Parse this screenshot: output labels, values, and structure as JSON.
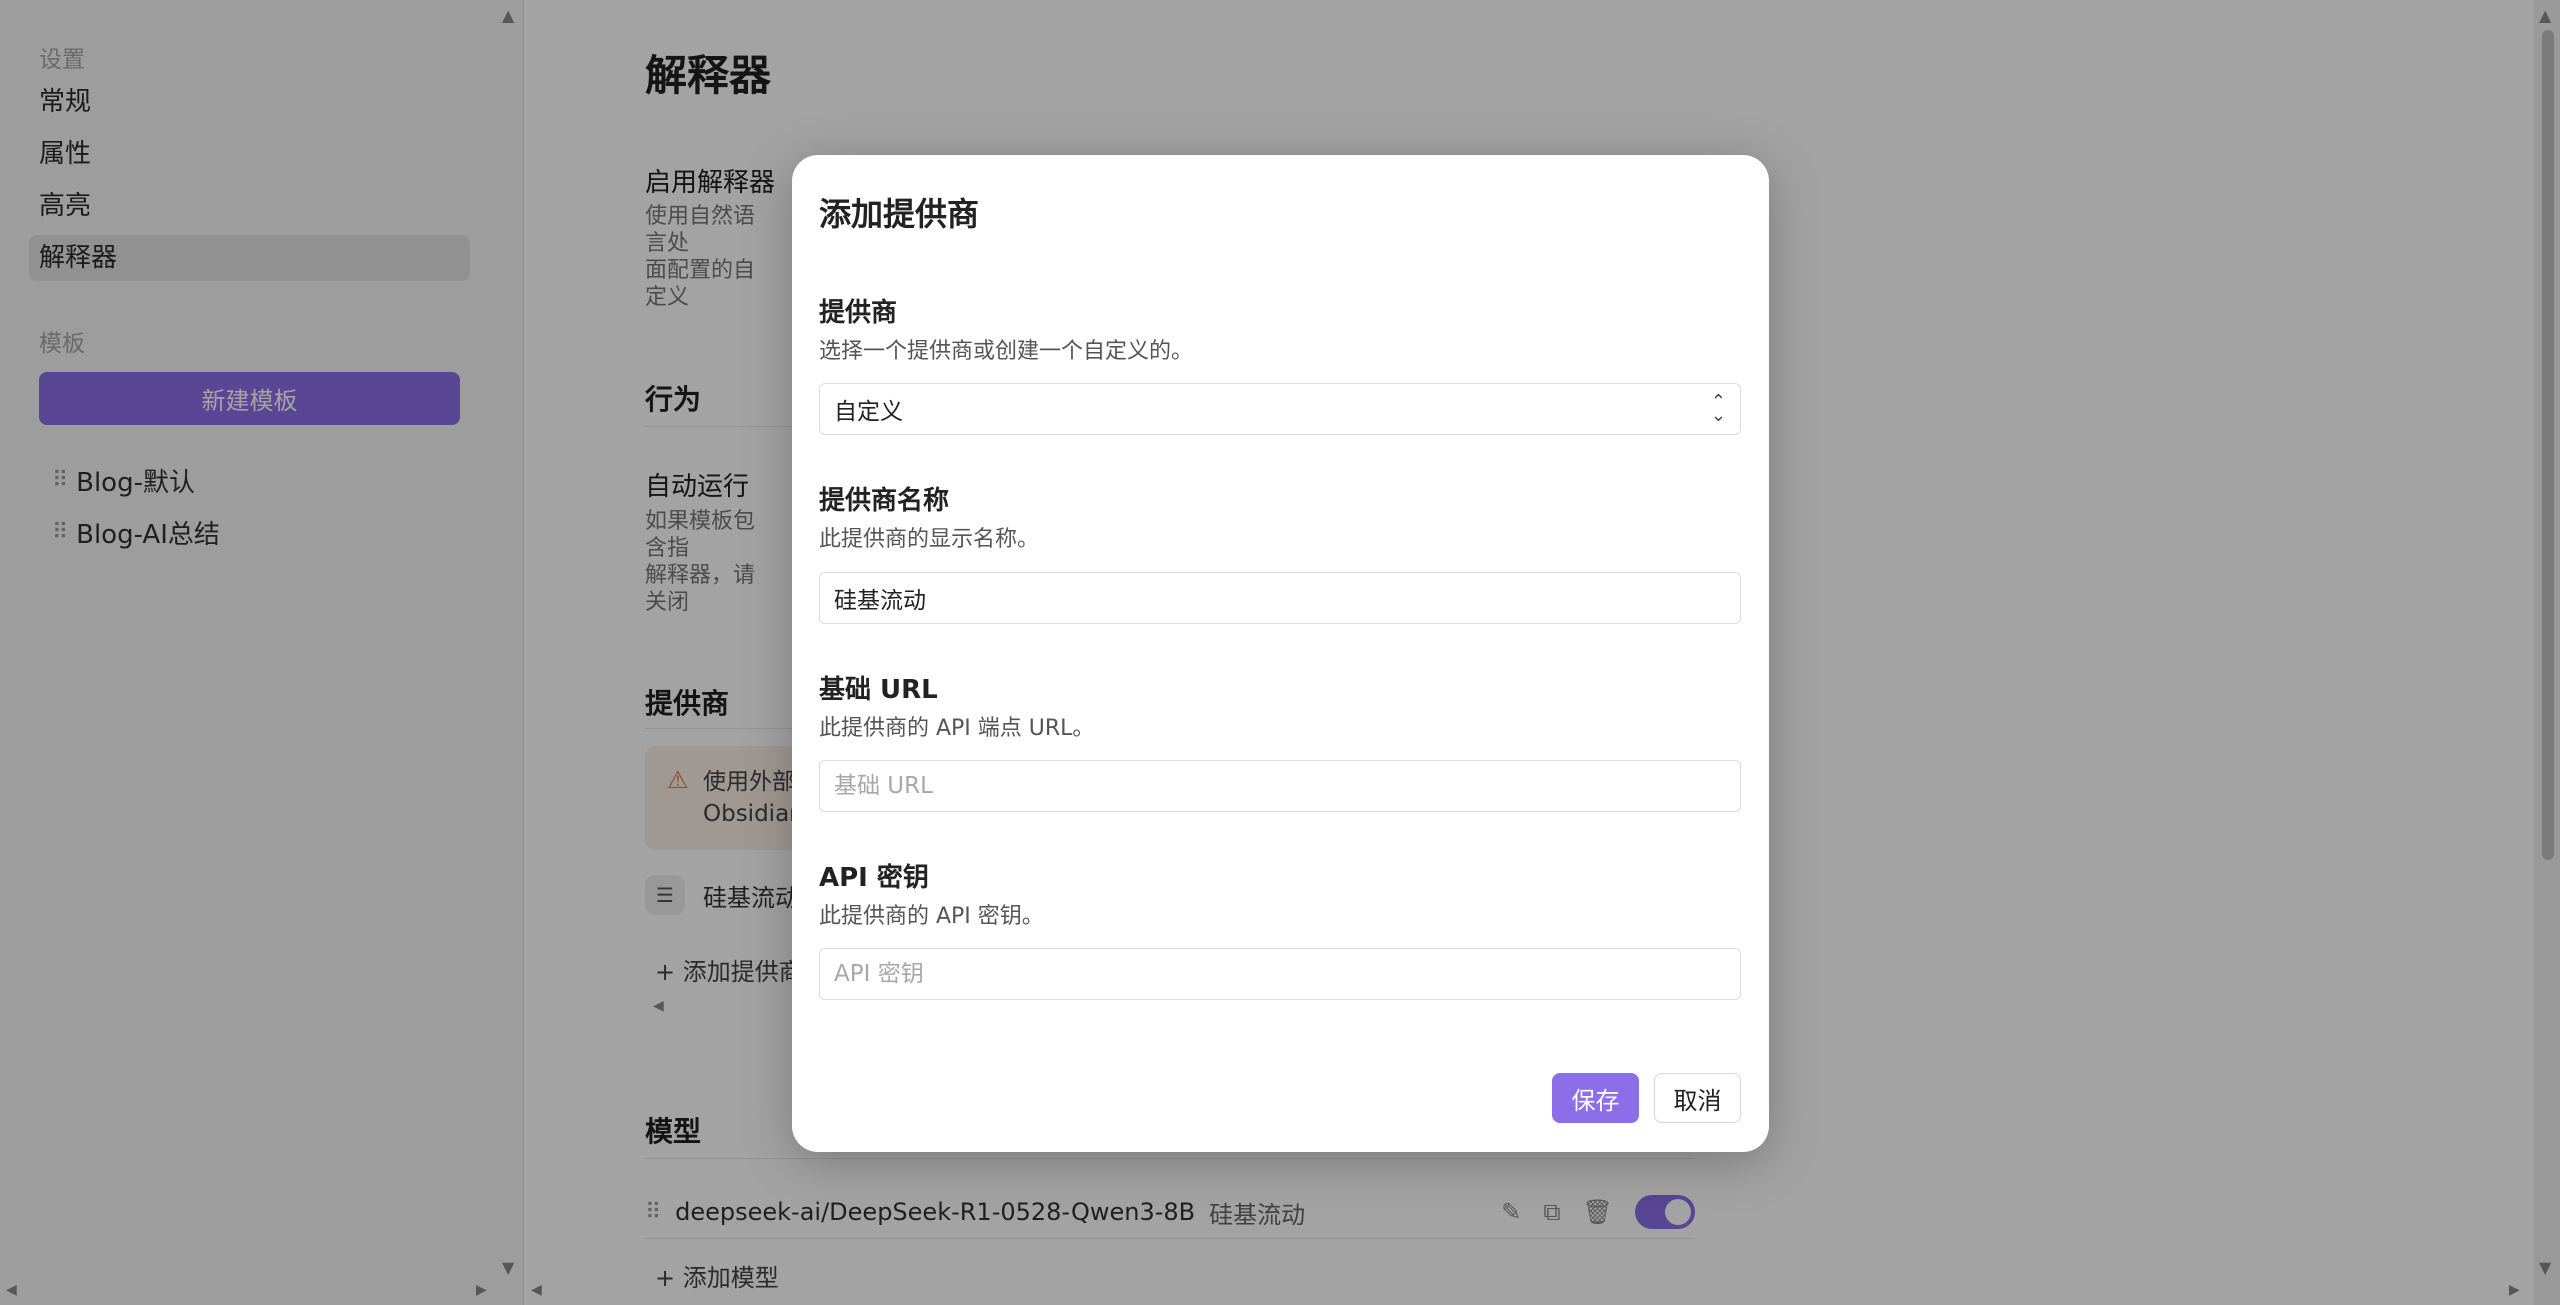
{
  "sidebar": {
    "settings_heading": "设置",
    "items": [
      {
        "label": "常规"
      },
      {
        "label": "属性"
      },
      {
        "label": "高亮"
      },
      {
        "label": "解释器"
      }
    ],
    "templates_heading": "模板",
    "new_template_label": "新建模板",
    "templates": [
      {
        "label": "Blog-默认"
      },
      {
        "label": "Blog-AI总结"
      }
    ]
  },
  "main": {
    "title": "解释器",
    "enable_name": "启用解释器",
    "enable_desc": "使用自然语言处\n面配置的自定义",
    "behavior_heading": "行为",
    "autorun_name": "自动运行",
    "autorun_desc": "如果模板包含指\n解释器，请关闭",
    "providers_heading": "提供商",
    "warning_text": "使用外部\nObsidian",
    "provider_item": "硅基流动",
    "add_provider_label": "+ 添加提供商",
    "models_heading": "模型",
    "model": {
      "name": "deepseek-ai/DeepSeek-R1-0528-Qwen3-8B",
      "provider": "硅基流动"
    },
    "add_model_label": "+ 添加模型"
  },
  "modal": {
    "title": "添加提供商",
    "provider_label": "提供商",
    "provider_desc": "选择一个提供商或创建一个自定义的。",
    "provider_value": "自定义",
    "name_label": "提供商名称",
    "name_desc": "此提供商的显示名称。",
    "name_value": "硅基流动",
    "url_label": "基础 URL",
    "url_desc": "此提供商的 API 端点 URL。",
    "url_placeholder": "基础 URL",
    "key_label": "API 密钥",
    "key_desc": "此提供商的 API 密钥。",
    "key_placeholder": "API 密钥",
    "save_label": "保存",
    "cancel_label": "取消"
  },
  "colors": {
    "accent": "#8b6ee8",
    "overlay": "rgba(0,0,0,0.36)",
    "warning_bg": "#fbeee6"
  },
  "icons": {
    "drag_handle": "drag-handle-icon",
    "warning": "warning-icon",
    "provider": "provider-icon",
    "edit": "pencil-icon",
    "copy": "copy-icon",
    "delete": "trash-icon"
  }
}
